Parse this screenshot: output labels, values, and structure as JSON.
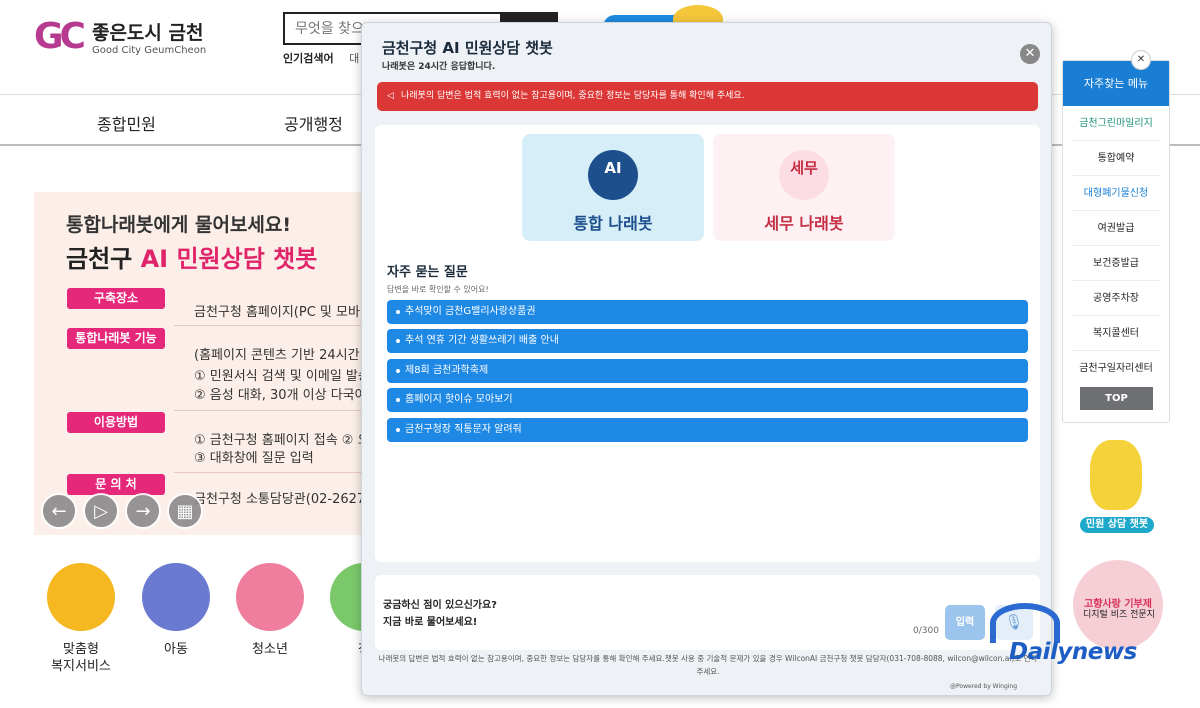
{
  "header": {
    "logo_mark": "GC",
    "logo_kr": "좋은도시 금천",
    "logo_en": "Good City GeumCheon",
    "search_placeholder": "무엇을 찾으",
    "popular_label": "인기검색어",
    "popular_first": "대"
  },
  "gnb": [
    "종합민원",
    "공개행정"
  ],
  "slide": {
    "line1": "통합나래봇에게 물어보세요!",
    "line2a": "금천구 ",
    "line2b": "AI 민원상담 챗봇",
    "rows": [
      {
        "pill": "구축장소",
        "text": [
          "금천구청 홈페이지(PC 및 모바일"
        ]
      },
      {
        "pill": "통합나래봇 기능",
        "text": [
          "(홈페이지 콘텐츠 기반 24시간 지",
          "① 민원서식 검색 및 이메일 발송",
          "② 음성 대화, 30개 이상 다국어 i"
        ]
      },
      {
        "pill": "이용방법",
        "text": [
          "① 금천구청 홈페이지 접속  ② 오",
          "③ 대화창에 질문 입력"
        ]
      },
      {
        "pill": "문 의 처",
        "text": [
          "금천구청 소통담당관(02-2627-"
        ]
      }
    ]
  },
  "categories": [
    {
      "label": "맞춤형\n복지서비스",
      "color": "#f5b820"
    },
    {
      "label": "아동",
      "color": "#6a7ad1"
    },
    {
      "label": "청소년",
      "color": "#ef7d9e"
    },
    {
      "label": "청",
      "color": "#7bc86a"
    }
  ],
  "modal": {
    "title": "금천구청 AI 민원상담 챗봇",
    "subtitle": "나래봇은 24시간 응답합니다.",
    "notice": "나래봇의 답변은 법적 효력이 없는 참고용이며, 중요한 정보는 담당자를 통해 확인해 주세요.",
    "cards": [
      {
        "icon": "AI",
        "label": "통합 나래봇"
      },
      {
        "icon": "세무",
        "label": "세무 나래봇"
      }
    ],
    "faq_title": "자주 묻는 질문",
    "faq_sub": "답변을 바로 확인할 수 있어요!",
    "faqs": [
      "추석맞이 금천G밸리사랑상품권",
      "추석 연휴 기간 생활쓰레기 배출 안내",
      "제8회 금천과학축제",
      "홈페이지 핫이슈 모아보기",
      "금천구청장 직통문자 알려줘"
    ],
    "input_placeholder1": "궁금하신 점이 있으신가요?",
    "input_placeholder2": "지금 바로 물어보세요!",
    "counter": "0/300",
    "send_label": "입력",
    "disclaimer": "나래봇의 답변은 법적 효력이 없는 참고용이며, 중요한 정보는 담당자를 통해 확인해 주세요.챗봇 사용 중 기술적 문제가 있을 경우 WilconAI 금천구청 챗봇 담당자(031-708-8088, wilcon@wilcon.ai)로 연락주세요.",
    "powered": "@Powered by Winging"
  },
  "quick": {
    "title": "자주찾는 메뉴",
    "items": [
      {
        "label": "금천그린마일리지",
        "color": "#1a8f7a"
      },
      {
        "label": "통합예약",
        "color": "#222"
      },
      {
        "label": "대형폐기물신청",
        "color": "#1a7fd4"
      },
      {
        "label": "여권발급",
        "color": "#222"
      },
      {
        "label": "보건증발급",
        "color": "#222"
      },
      {
        "label": "공영주차장",
        "color": "#222"
      },
      {
        "label": "복지콜센터",
        "color": "#222"
      },
      {
        "label": "금천구일자리센터",
        "color": "#222"
      }
    ],
    "top": "TOP"
  },
  "chat_badge": "민원 상담 챗봇",
  "deco_text": "고향사랑 기부제",
  "watermark": {
    "line": "디지털 비즈 전문지",
    "brand": "Dailynews"
  }
}
